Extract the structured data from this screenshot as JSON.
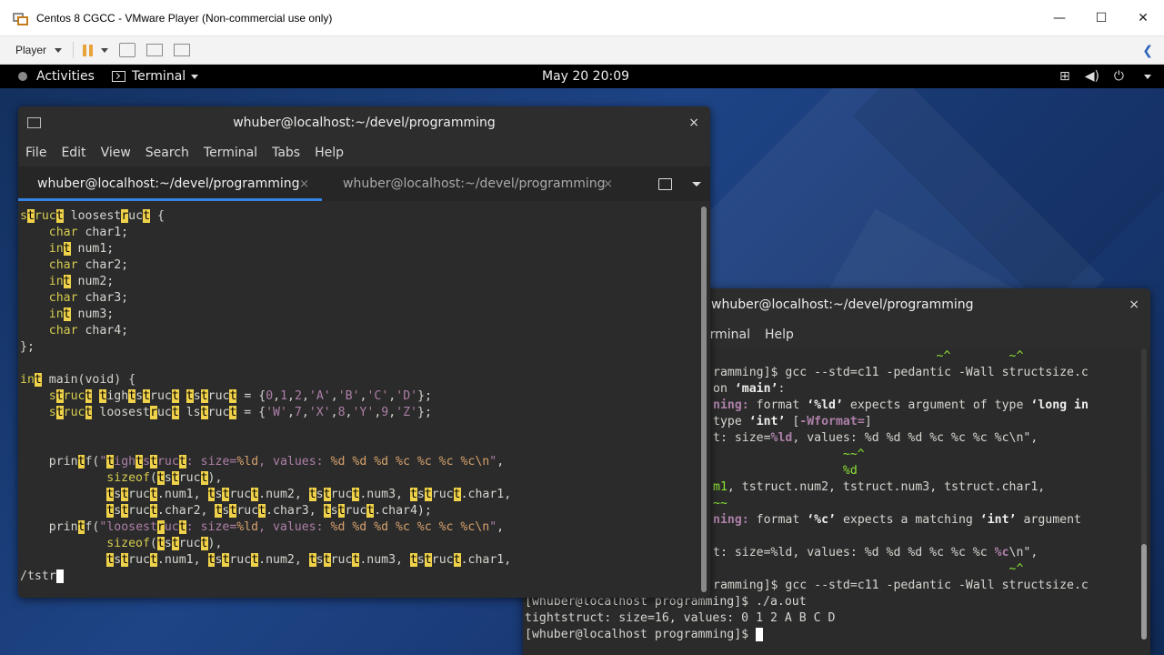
{
  "vm": {
    "title": "Centos 8 CGCC - VMware Player (Non-commercial use only)",
    "player_label": "Player",
    "minimize": "—",
    "maximize": "☐",
    "close": "✕",
    "back": "❮"
  },
  "gnome": {
    "activities": "Activities",
    "app_menu": "Terminal",
    "clock": "May 20  20:09"
  },
  "front_terminal": {
    "title": "whuber@localhost:~/devel/programming",
    "close": "×",
    "menu": [
      "File",
      "Edit",
      "View",
      "Search",
      "Terminal",
      "Tabs",
      "Help"
    ],
    "tabs": [
      {
        "label": "whuber@localhost:~/devel/programming",
        "close": "×"
      },
      {
        "label": "whuber@localhost:~/devel/programming",
        "close": "×"
      }
    ],
    "search_prompt": "/tstr"
  },
  "back_terminal": {
    "title": "whuber@localhost:~/devel/programming",
    "close": "×",
    "menu": [
      "erminal",
      "Help"
    ]
  },
  "colors": {
    "accent": "#3584e4",
    "highlight": "#f0d24a",
    "keyword": "#d6cd4f",
    "string": "#ad7fa8"
  }
}
